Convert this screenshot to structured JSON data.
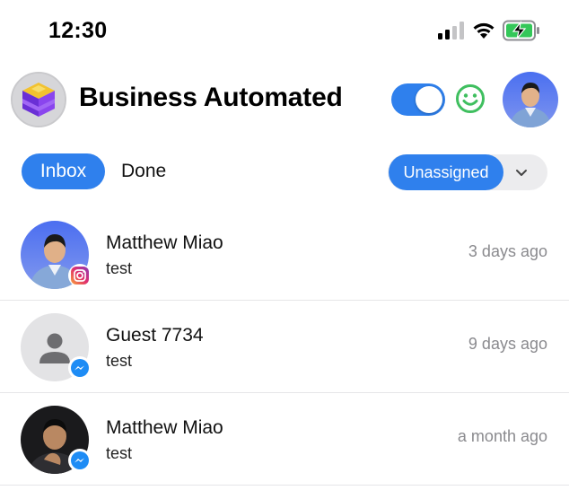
{
  "status_bar": {
    "time": "12:30"
  },
  "header": {
    "title": "Business Automated",
    "availability_on": true,
    "accent_color": "#2f80ed",
    "status_color": "#3fbf5f"
  },
  "filters": {
    "tabs": [
      {
        "label": "Inbox",
        "active": true
      },
      {
        "label": "Done",
        "active": false
      }
    ],
    "assignment": {
      "selected": "Unassigned"
    }
  },
  "conversations": [
    {
      "name": "Matthew Miao",
      "preview": "test",
      "time": "3 days ago",
      "channel": "instagram-icon",
      "avatar": "photo"
    },
    {
      "name": "Guest 7734",
      "preview": "test",
      "time": "9 days ago",
      "channel": "messenger-icon",
      "avatar": "placeholder"
    },
    {
      "name": "Matthew Miao",
      "preview": "test",
      "time": "a month ago",
      "channel": "messenger-icon",
      "avatar": "photo-dark"
    }
  ]
}
